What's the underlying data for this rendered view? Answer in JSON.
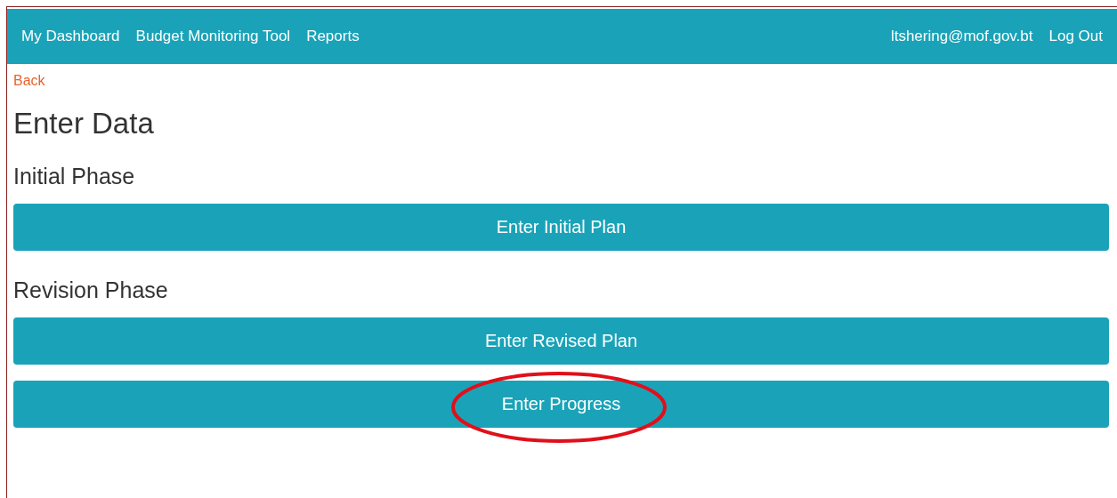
{
  "nav": {
    "links": [
      {
        "label": "My Dashboard"
      },
      {
        "label": "Budget Monitoring Tool"
      },
      {
        "label": "Reports"
      }
    ],
    "user": "ltshering@mof.gov.bt",
    "logout": "Log Out"
  },
  "back": "Back",
  "title": "Enter Data",
  "sections": [
    {
      "heading": "Initial Phase",
      "buttons": [
        {
          "label": "Enter Initial Plan",
          "circled": false
        }
      ]
    },
    {
      "heading": "Revision Phase",
      "buttons": [
        {
          "label": "Enter Revised Plan",
          "circled": false
        },
        {
          "label": "Enter Progress",
          "circled": true
        }
      ]
    }
  ]
}
